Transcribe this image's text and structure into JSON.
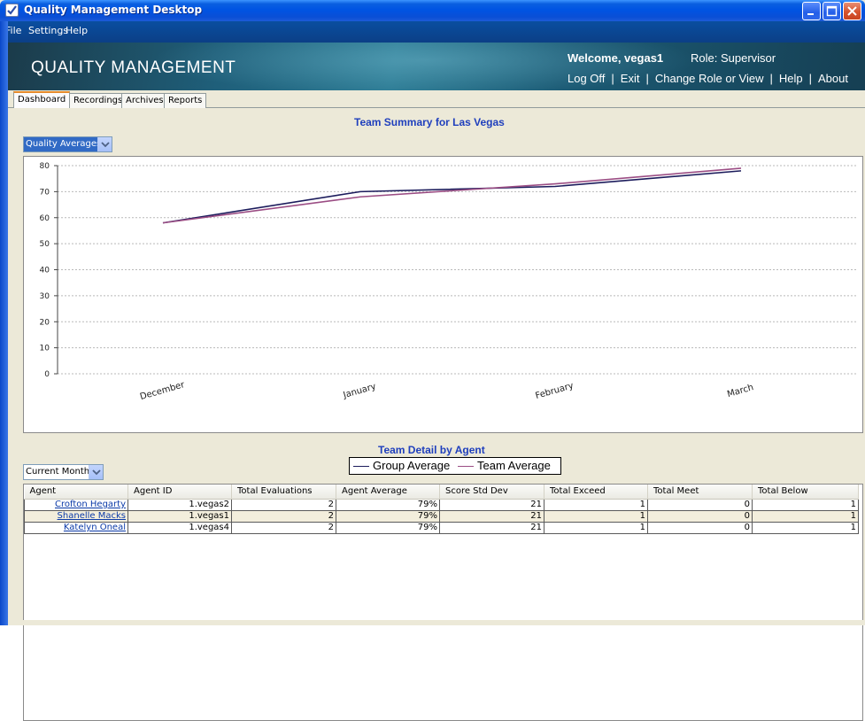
{
  "window": {
    "title": "Quality Management Desktop"
  },
  "menu": [
    "File",
    "Settings",
    "Help"
  ],
  "banner": {
    "brand": "QUALITY MANAGEMENT",
    "welcome": "Welcome, vegas1",
    "role": "Role: Supervisor",
    "links": [
      "Log Off",
      "Exit",
      "Change Role or View",
      "Help",
      "About"
    ]
  },
  "tabs": [
    "Dashboard",
    "Recordings",
    "Archives",
    "Reports"
  ],
  "summary": {
    "title": "Team Summary for Las Vegas",
    "dropdown_value": "Quality Averages"
  },
  "chart_data": {
    "type": "line",
    "categories": [
      "December",
      "January",
      "February",
      "March"
    ],
    "series": [
      {
        "name": "Group Average",
        "color": "#1c1c5c",
        "values": [
          58,
          70,
          72,
          78
        ]
      },
      {
        "name": "Team Average",
        "color": "#9b4d84",
        "values": [
          58,
          68,
          73,
          79
        ]
      }
    ],
    "ylim": [
      0,
      80
    ],
    "yticks": [
      0,
      10,
      20,
      30,
      40,
      50,
      60,
      70,
      80
    ],
    "grid": true,
    "legend": "bottom-center"
  },
  "detail": {
    "title": "Team Detail by Agent",
    "dropdown_value": "Current Month",
    "columns": [
      "Agent",
      "Agent ID",
      "Total Evaluations",
      "Agent Average",
      "Score Std Dev",
      "Total Exceed",
      "Total Meet",
      "Total Below"
    ],
    "rows": [
      [
        "Crofton Hegarty",
        "1.vegas2",
        "2",
        "79%",
        "21",
        "1",
        "0",
        "1"
      ],
      [
        "Shanelle Macks",
        "1.vegas1",
        "2",
        "79%",
        "21",
        "1",
        "0",
        "1"
      ],
      [
        "Katelyn Oneal",
        "1.vegas4",
        "2",
        "79%",
        "21",
        "1",
        "0",
        "1"
      ]
    ]
  }
}
